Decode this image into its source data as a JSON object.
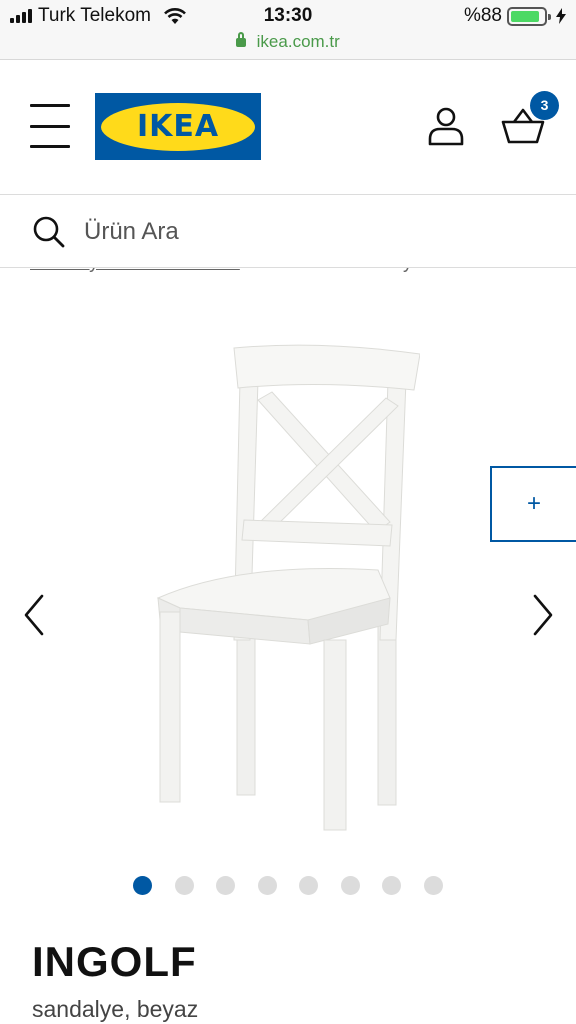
{
  "status_bar": {
    "carrier": "Turk Telekom",
    "time": "13:30",
    "battery": "%88",
    "battery_level": 0.88,
    "signal_icon": "signal-bars-icon",
    "wifi_icon": "wifi-icon",
    "charging_icon": "bolt-icon"
  },
  "browser": {
    "url": "ikea.com.tr",
    "lock_icon": "lock-icon"
  },
  "header": {
    "menu_icon": "hamburger-menu-icon",
    "logo_text": "IKEA",
    "account_icon": "user-icon",
    "cart_icon": "basket-icon",
    "cart_count": "3",
    "brand_blue": "#0058a3",
    "brand_yellow": "#ffda1a"
  },
  "search": {
    "placeholder": "Ürün Ara",
    "icon": "search-icon"
  },
  "breadcrumb": {
    "items": [
      "Sandalyeler ve Tabureler",
      "INGOLF sandalye"
    ],
    "separator": ">"
  },
  "gallery": {
    "image": "chair-image",
    "prev_icon": "chevron-left-icon",
    "next_icon": "chevron-right-icon",
    "zoom_label": "+",
    "dot_count": 8,
    "active_dot": 1
  },
  "product": {
    "name": "INGOLF",
    "description": "sandalye, beyaz"
  }
}
